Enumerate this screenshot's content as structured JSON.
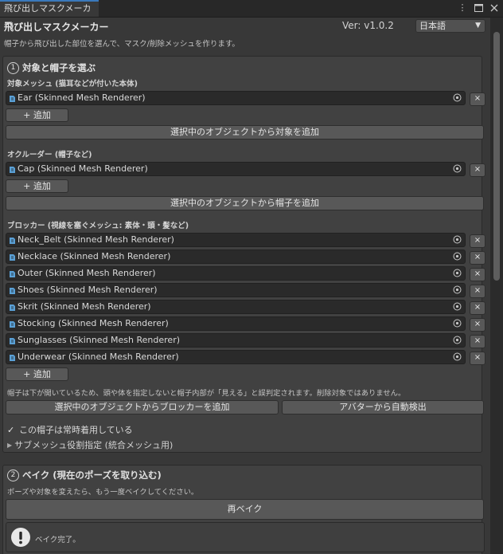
{
  "tab": {
    "title": "飛び出しマスクメーカー"
  },
  "header": {
    "title": "飛び出しマスクメーカー",
    "version": "Ver: v1.0.2",
    "language": "日本語",
    "description": "帽子から飛び出した部位を選んで、マスク/削除メッシュを作ります。"
  },
  "section1": {
    "number": "1",
    "title": "対象と帽子を選ぶ",
    "target_label": "対象メッシュ (猫耳などが付いた本体)",
    "targets": [
      "Ear (Skinned Mesh Renderer)"
    ],
    "add_label": "+ 追加",
    "add_selected_target": "選択中のオブジェクトから対象を追加",
    "occluder_label": "オクルーダー (帽子など)",
    "occluders": [
      "Cap (Skinned Mesh Renderer)"
    ],
    "add_selected_hat": "選択中のオブジェクトから帽子を追加",
    "blocker_label": "ブロッカー (視線を塞ぐメッシュ: 素体・頭・髪など)",
    "blockers": [
      "Neck_Belt (Skinned Mesh Renderer)",
      "Necklace (Skinned Mesh Renderer)",
      "Outer (Skinned Mesh Renderer)",
      "Shoes (Skinned Mesh Renderer)",
      "Skrit (Skinned Mesh Renderer)",
      "Stocking (Skinned Mesh Renderer)",
      "Sunglasses (Skinned Mesh Renderer)",
      "Underwear (Skinned Mesh Renderer)"
    ],
    "note": "帽子は下が開いているため、頭や体を指定しないと帽子内部が「見える」と誤判定されます。削除対象ではありません。",
    "add_selected_blocker": "選択中のオブジェクトからブロッカーを追加",
    "auto_detect": "アバターから自動検出",
    "always_worn": "この帽子は常時着用している",
    "submesh_role": "サブメッシュ役割指定 (統合メッシュ用)"
  },
  "section2": {
    "number": "2",
    "title": "ベイク (現在のポーズを取り込む)",
    "description": "ポーズや対象を変えたら、もう一度ベイクしてください。",
    "rebake": "再ベイク",
    "status": "ベイク完了。"
  },
  "icons": {
    "remove": "×",
    "check": "✓",
    "fold": "▶",
    "menu": "⋮"
  }
}
